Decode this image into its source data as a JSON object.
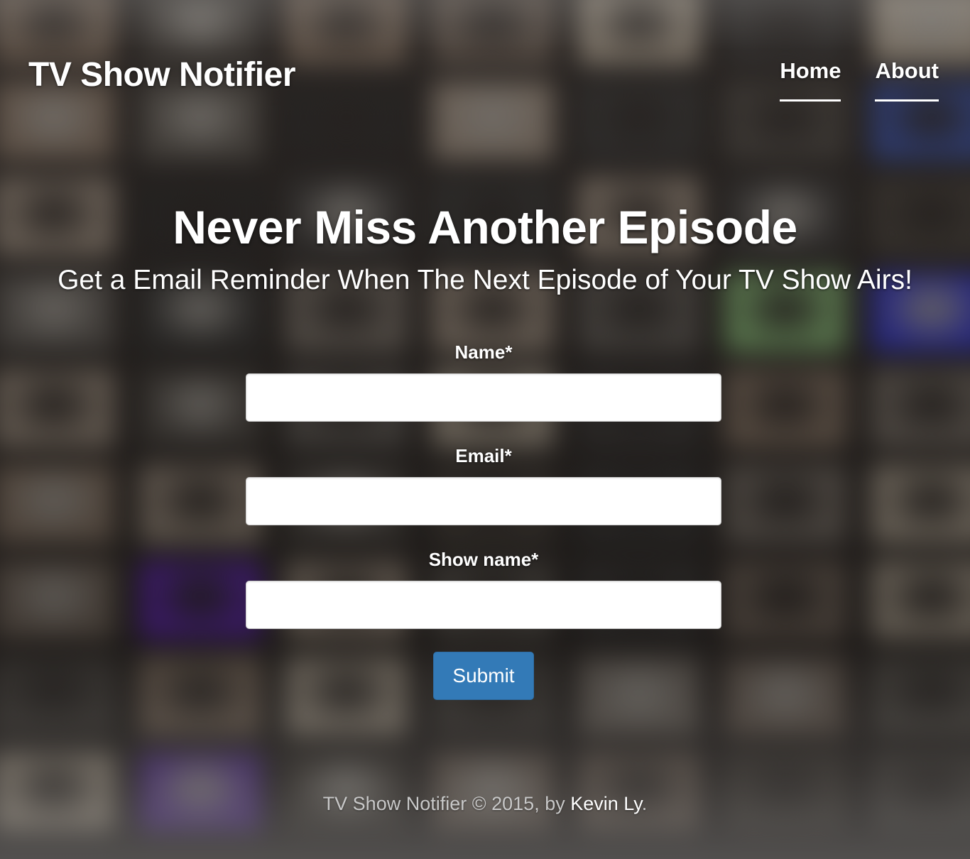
{
  "brand": "TV Show Notifier",
  "nav": {
    "home": "Home",
    "about": "About"
  },
  "hero": {
    "heading": "Never Miss Another Episode",
    "subheading": "Get a Email Reminder When The Next Episode of Your TV Show Airs!"
  },
  "form": {
    "name_label": "Name*",
    "name_value": "",
    "email_label": "Email*",
    "email_value": "",
    "show_label": "Show name*",
    "show_value": "",
    "submit_label": "Submit"
  },
  "footer": {
    "prefix": "TV Show Notifier © 2015, by ",
    "author": "Kevin Ly",
    "suffix": "."
  },
  "colors": {
    "primary_button": "#337ab7",
    "text": "#ffffff",
    "footer_text": "#c8c8c8"
  }
}
